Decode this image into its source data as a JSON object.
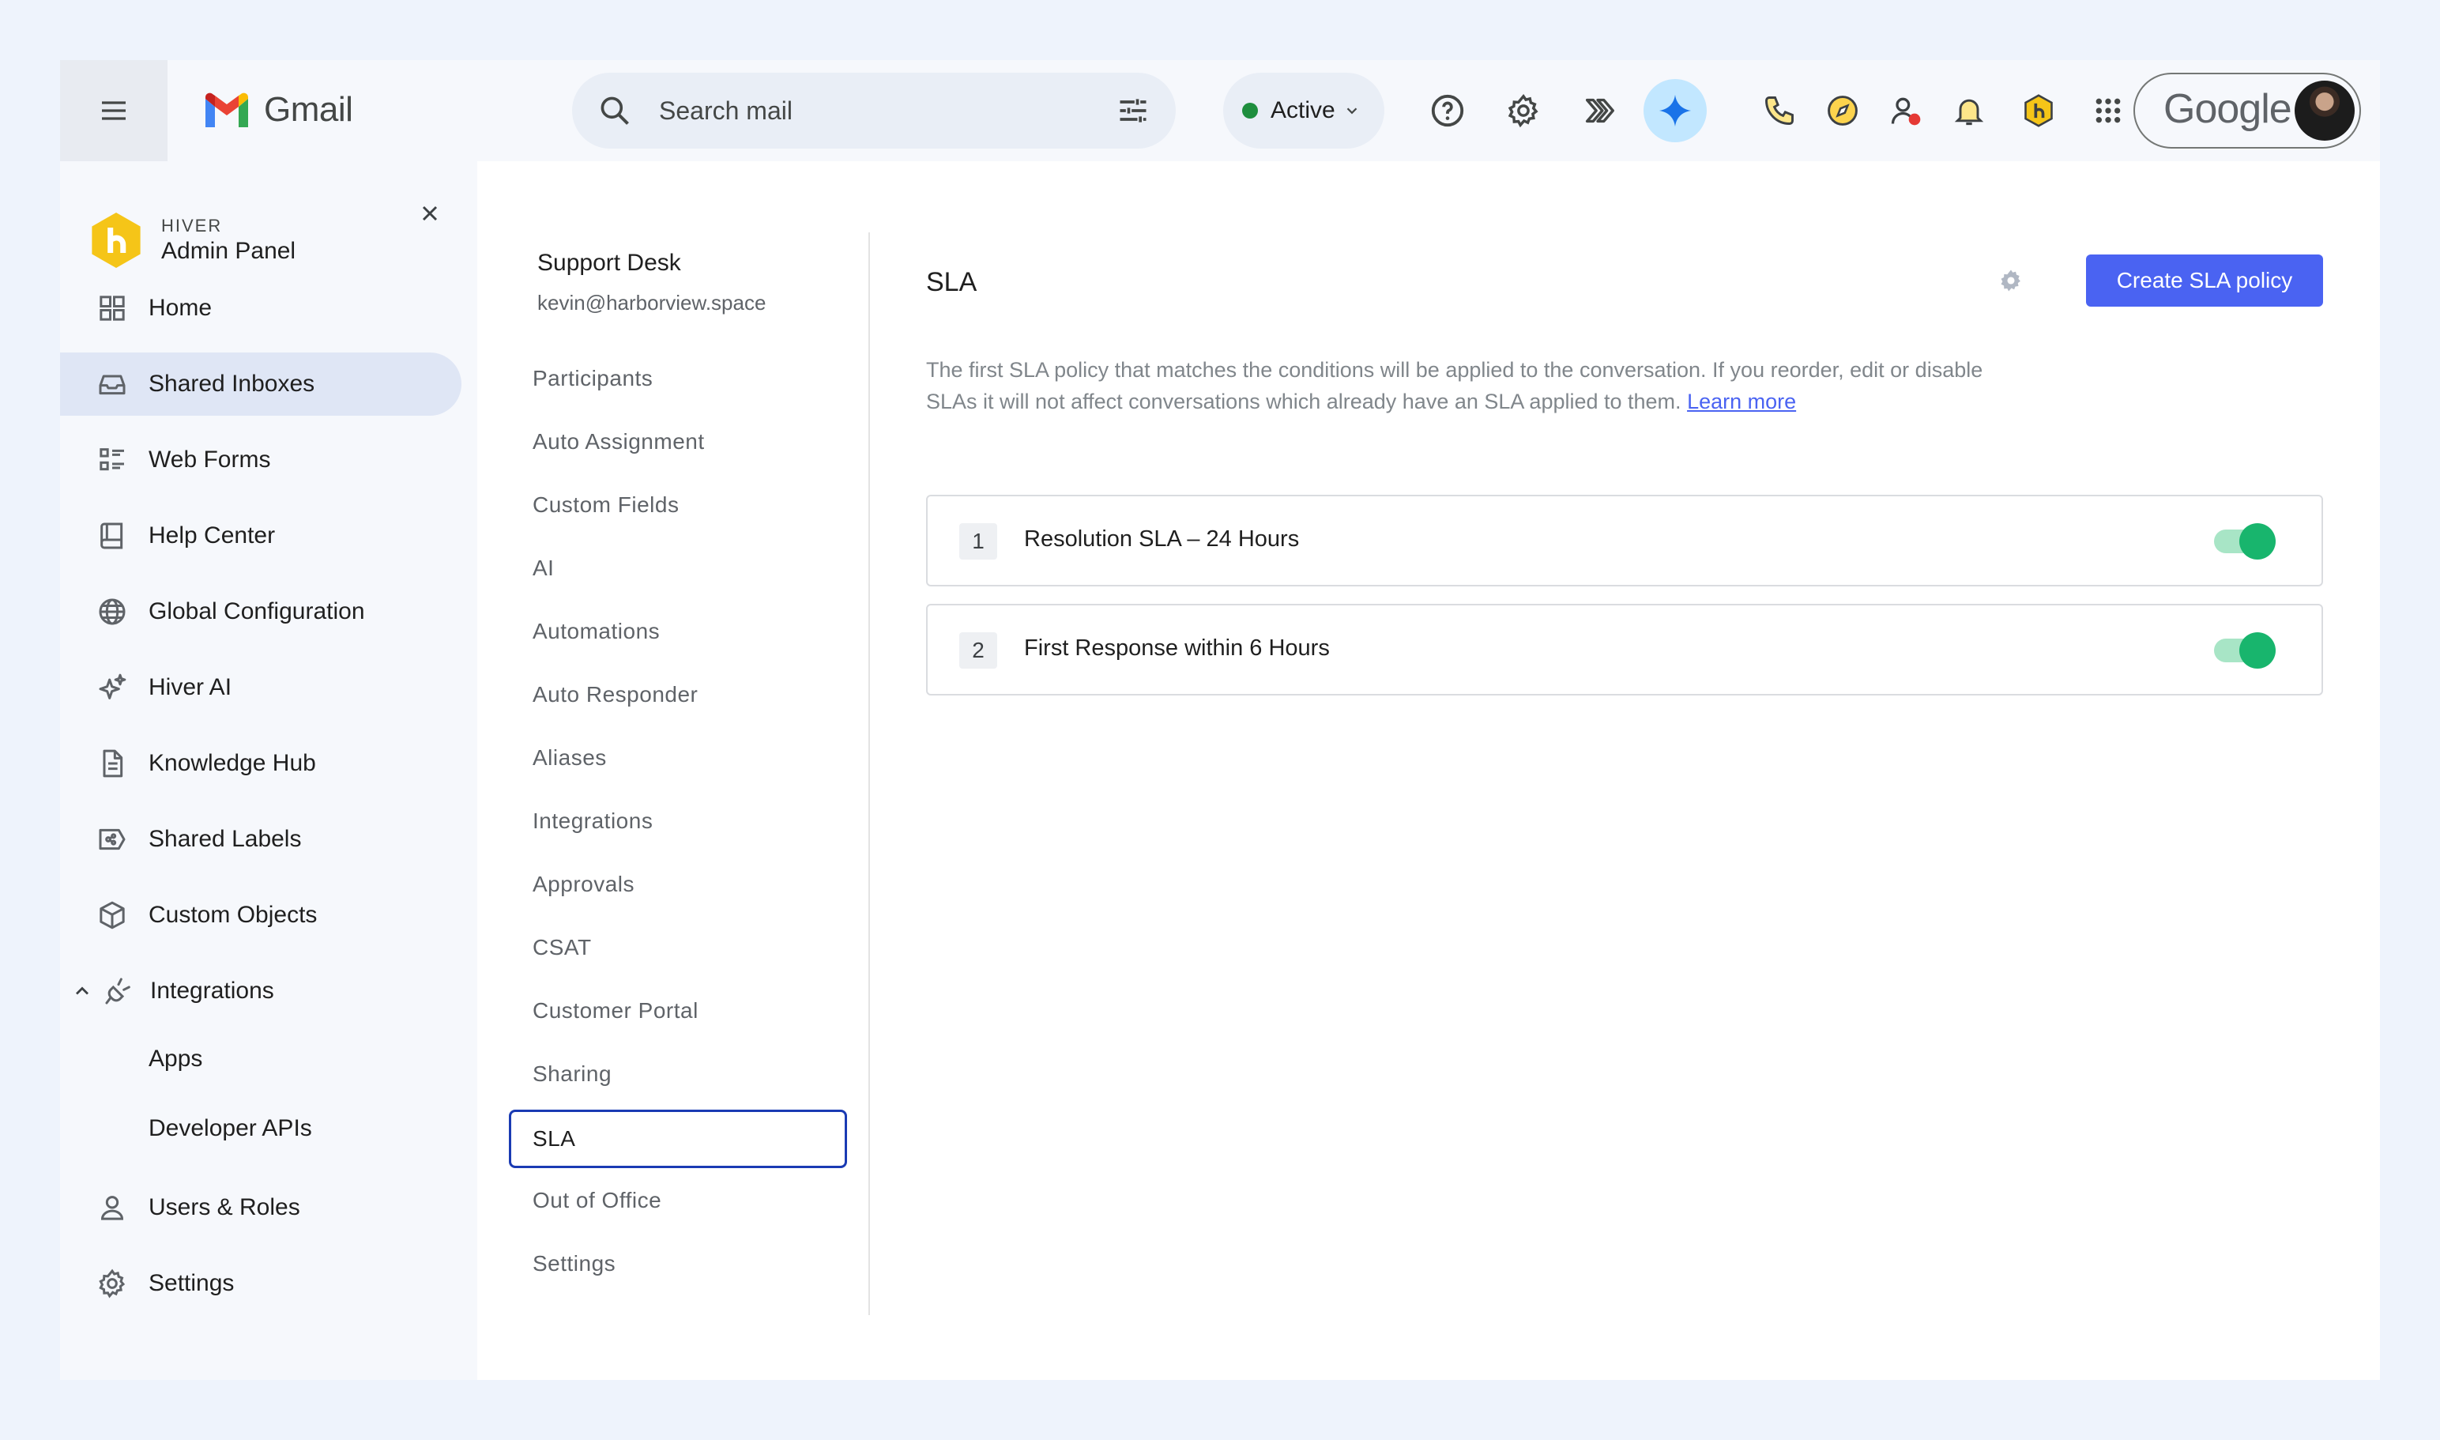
{
  "topbar": {
    "app_name": "Gmail",
    "search_placeholder": "Search mail",
    "status_label": "Active",
    "account_brand": "Google",
    "colors": {
      "status_dot": "#1e8e3e",
      "gemini_bg": "#c2e7ff"
    }
  },
  "sidebar": {
    "brand_small": "HIVER",
    "brand_title": "Admin Panel",
    "items": [
      {
        "label": "Home",
        "icon": "grid-icon"
      },
      {
        "label": "Shared Inboxes",
        "icon": "inbox-icon",
        "active": true
      },
      {
        "label": "Web Forms",
        "icon": "form-list-icon"
      },
      {
        "label": "Help Center",
        "icon": "book-icon"
      },
      {
        "label": "Global Configuration",
        "icon": "globe-icon"
      },
      {
        "label": "Hiver AI",
        "icon": "sparkle-icon"
      },
      {
        "label": "Knowledge Hub",
        "icon": "document-icon"
      },
      {
        "label": "Shared Labels",
        "icon": "label-share-icon"
      },
      {
        "label": "Custom Objects",
        "icon": "cube-icon"
      },
      {
        "label": "Integrations",
        "icon": "plug-icon",
        "expanded": true
      },
      {
        "label": "Apps",
        "sub": true
      },
      {
        "label": "Developer APIs",
        "sub": true
      },
      {
        "label": "Users & Roles",
        "icon": "user-icon"
      },
      {
        "label": "Settings",
        "icon": "gear-icon"
      }
    ]
  },
  "inbox": {
    "name": "Support Desk",
    "email": "kevin@harborview.space",
    "sections": [
      "Participants",
      "Auto Assignment",
      "Custom Fields",
      "AI",
      "Automations",
      "Auto Responder",
      "Aliases",
      "Integrations",
      "Approvals",
      "CSAT",
      "Customer Portal",
      "Sharing",
      "SLA",
      "Out of Office",
      "Settings"
    ],
    "active_section": "SLA"
  },
  "sla": {
    "title": "SLA",
    "create_button": "Create SLA policy",
    "description": "The first SLA policy that matches the conditions will be applied to the conversation. If you reorder, edit or disable SLAs it will not affect conversations which already have an SLA applied to them.",
    "learn_more": "Learn more",
    "policies": [
      {
        "index": "1",
        "name": "Resolution SLA – 24 Hours",
        "enabled": true
      },
      {
        "index": "2",
        "name": "First Response within 6 Hours",
        "enabled": true
      }
    ],
    "colors": {
      "primary": "#4a63f2",
      "toggle_on": "#18b56d"
    }
  }
}
